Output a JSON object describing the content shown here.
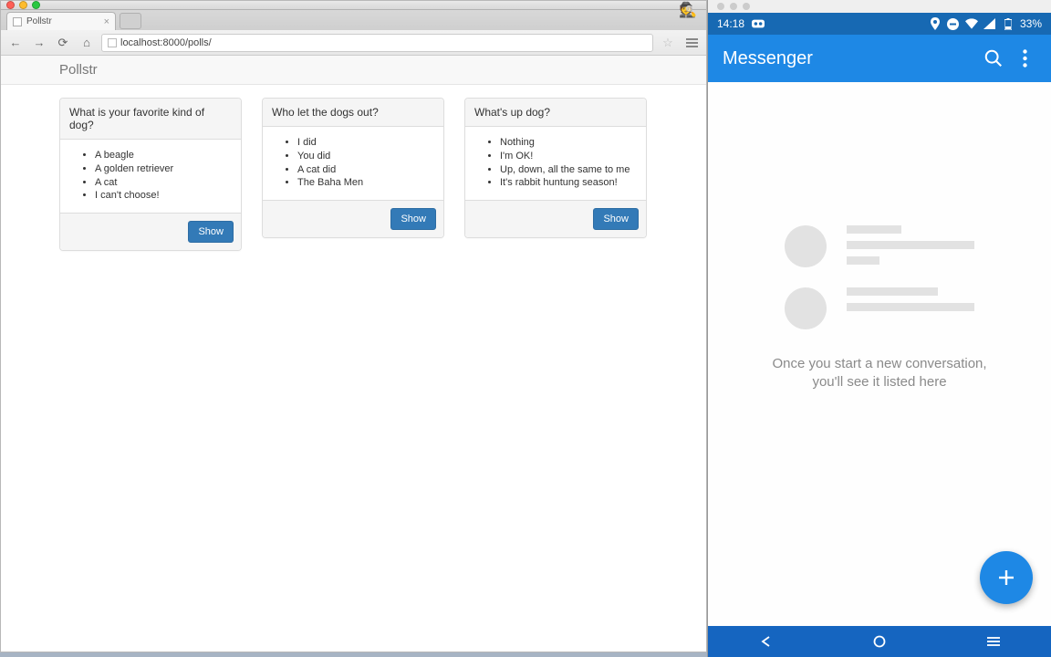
{
  "browser": {
    "tab_title": "Pollstr",
    "url": "localhost:8000/polls/",
    "app_title": "Pollstr",
    "show_label": "Show",
    "polls": [
      {
        "question": "What is your favorite kind of dog?",
        "options": [
          "A beagle",
          "A golden retriever",
          "A cat",
          "I can't choose!"
        ]
      },
      {
        "question": "Who let the dogs out?",
        "options": [
          "I did",
          "You did",
          "A cat did",
          "The Baha Men"
        ]
      },
      {
        "question": "What's up dog?",
        "options": [
          "Nothing",
          "I'm OK!",
          "Up, down, all the same to me",
          "It's rabbit huntung season!"
        ]
      }
    ]
  },
  "android": {
    "status": {
      "time": "14:18",
      "battery": "33%"
    },
    "app_title": "Messenger",
    "empty_line1": "Once you start a new conversation,",
    "empty_line2": "you'll see it listed here"
  }
}
